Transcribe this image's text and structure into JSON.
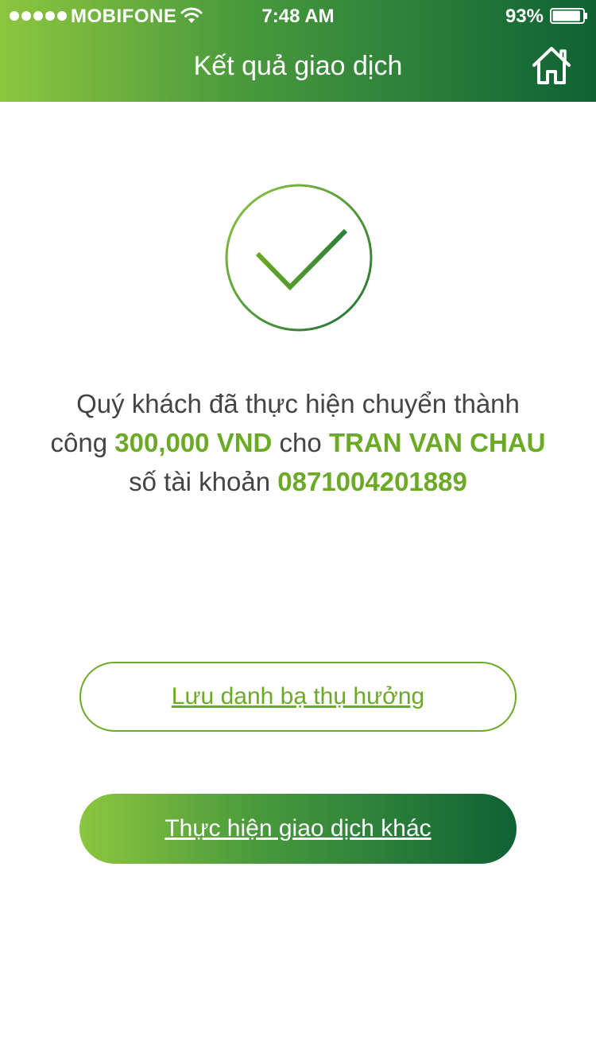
{
  "status_bar": {
    "carrier": "MOBIFONE",
    "time": "7:48 AM",
    "battery": "93%",
    "battery_level": 0.93,
    "signal_bars": 5
  },
  "header": {
    "title": "Kết quả giao dịch",
    "home_icon": "home-icon"
  },
  "result": {
    "icon": "checkmark-circle-icon",
    "text_1": "Quý khách đã thực hiện chuyển thành công ",
    "amount": "300,000 VND",
    "text_2": " cho ",
    "recipient": "TRAN VAN CHAU",
    "text_3": " số tài khoản ",
    "account_number": "0871004201889"
  },
  "buttons": {
    "save_contact": "Lưu danh bạ thụ hưởng",
    "new_transaction": "Thực hiện giao dịch khác"
  },
  "colors": {
    "accent_green": "#6aaa24",
    "gradient_start": "#8dc63f",
    "gradient_end": "#0f6133",
    "text": "#444444"
  }
}
